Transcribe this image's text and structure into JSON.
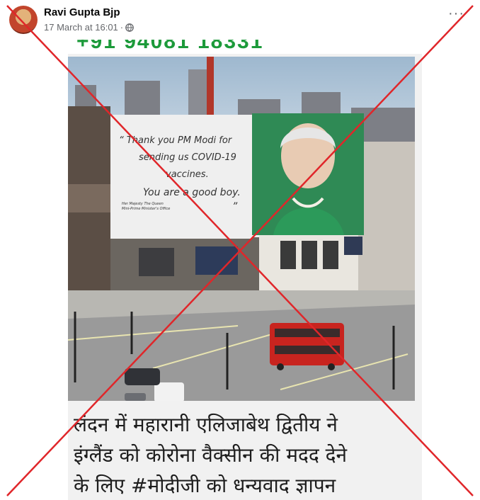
{
  "post": {
    "author": "Ravi Gupta Bjp",
    "timestamp": "17 March at 16:01",
    "separator": "·",
    "privacy_icon": "globe-icon",
    "more_label": "···"
  },
  "image": {
    "top_text": "+91 94081 18331",
    "billboard": {
      "line1": "“ Thank you PM Modi  for",
      "line2": "sending us COVID-19",
      "line3": "vaccines.",
      "line4": "You are a good boy.",
      "close_quote": "”",
      "small1": "Her Majesty The Queen",
      "small2": "Mini-Prime Minister's Office"
    },
    "caption_lines": [
      "लंदन में महारानी एलिजाबेथ द्वितीय ने",
      "इंग्लैंड को कोरोना वैक्सीन की मदद देने",
      "के लिए #मोदीजी को धन्यवाद ज्ञापन"
    ]
  },
  "overlay": {
    "cross_color": "#e0262a"
  },
  "colors": {
    "author": "#050505",
    "meta": "#65676b",
    "phone": "#1c9a3a",
    "bus": "#c8241f"
  }
}
